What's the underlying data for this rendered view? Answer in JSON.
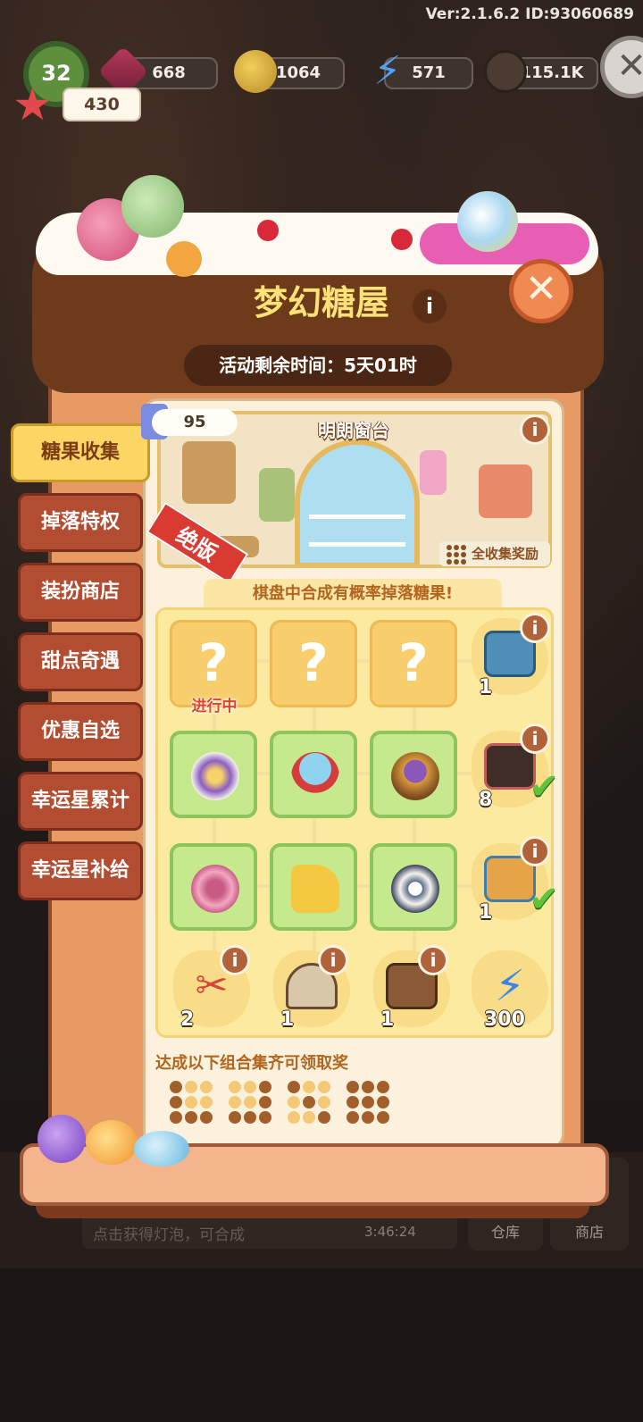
{
  "hud": {
    "version": "Ver:2.1.6.2 ID:93060689",
    "level": "32",
    "gems": "668",
    "coins": "1064",
    "energy": "571",
    "seeds": "115.1K",
    "stars": "430",
    "close_glyph": "✕"
  },
  "background": {
    "hint_text": "点击获得灯泡，可合成",
    "timer": "3:46:24",
    "warehouse_label": "仓库",
    "shop_label": "商店"
  },
  "panel": {
    "title": "梦幻糖屋",
    "info_glyph": "i",
    "close_glyph": "✕",
    "remaining_label": "活动剩余时间：",
    "remaining_value": "5天01时"
  },
  "tabs": [
    {
      "label": "糖果收集",
      "active": true
    },
    {
      "label": "掉落特权",
      "active": false
    },
    {
      "label": "装扮商店",
      "active": false
    },
    {
      "label": "甜点奇遇",
      "active": false
    },
    {
      "label": "优惠自选",
      "active": false
    },
    {
      "label": "幸运星累计",
      "active": false
    },
    {
      "label": "幸运星补给",
      "active": false
    }
  ],
  "showcase": {
    "progress": "95",
    "name": "明朗窗台",
    "sold_out": "绝版",
    "full_collect": "全收集奖励"
  },
  "board": {
    "hint": "棋盘中合成有概率掉落糖果!",
    "locked_glyph": "?",
    "in_progress": "进行中",
    "row_rewards": [
      {
        "icon": "treasure-chest-icon",
        "count": "1",
        "claimed": false
      },
      {
        "icon": "cat-bag-icon",
        "count": "8",
        "claimed": true
      },
      {
        "icon": "gift-box-icon",
        "count": "1",
        "claimed": true
      }
    ],
    "col_rewards": [
      {
        "icon": "scissors-icon",
        "count": "2"
      },
      {
        "icon": "house-add-icon",
        "count": "1"
      },
      {
        "icon": "wooden-crate-icon",
        "count": "1"
      },
      {
        "icon": "energy-bolt-icon",
        "count": "300"
      }
    ]
  },
  "combos": {
    "title": "达成以下组合集齐可领取奖"
  },
  "colors": {
    "panel_brown": "#6e3a1c",
    "tab_red": "#b24d32",
    "tab_active": "#fcd664",
    "board_yellow": "#fbeaa0",
    "cell_green": "#c7e98e",
    "check_green": "#5fc43b"
  }
}
